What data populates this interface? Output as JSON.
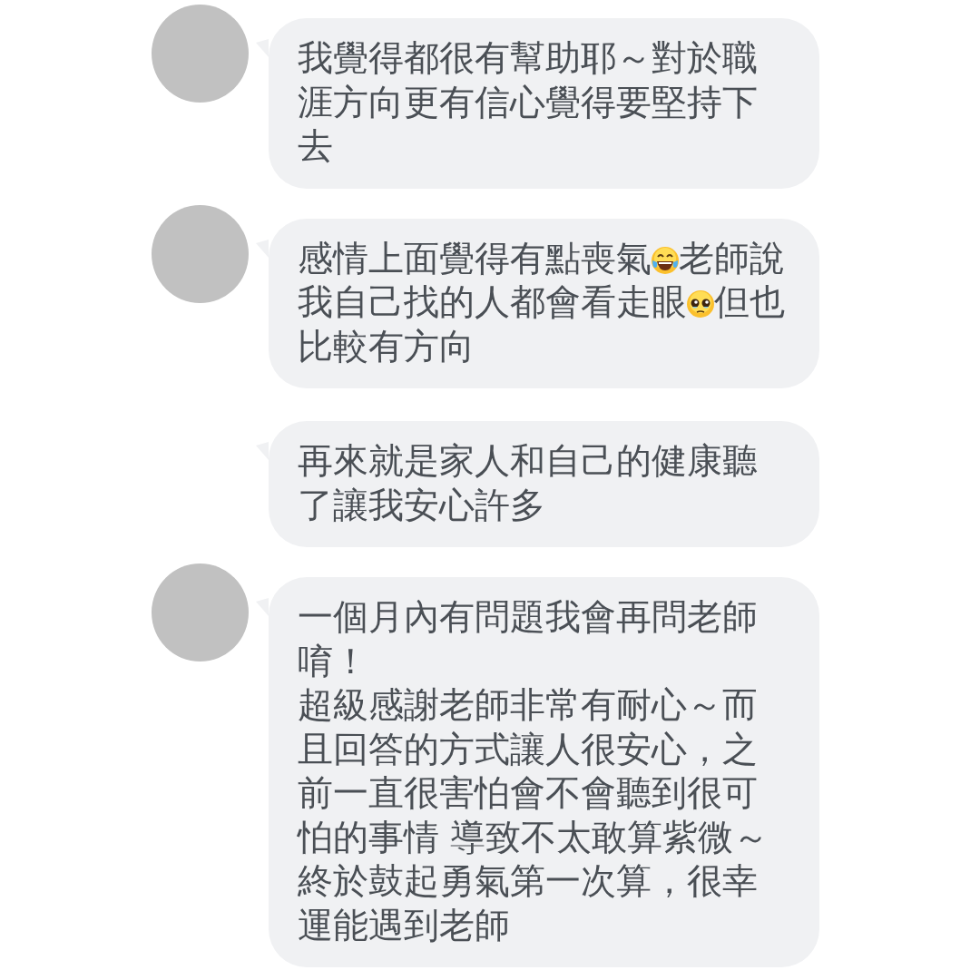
{
  "messages": [
    {
      "show_avatar": true,
      "parts": [
        {
          "kind": "text",
          "text": "我覺得都很有幫助耶～對於職涯方向更有信心覺得要堅持下去"
        }
      ]
    },
    {
      "show_avatar": true,
      "parts": [
        {
          "kind": "text",
          "text": "感情上面覺得有點喪氣"
        },
        {
          "kind": "emoji"
        },
        {
          "kind": "text",
          "text": "老師說我自己找的人都會看走眼"
        },
        {
          "kind": "emoji"
        },
        {
          "kind": "text",
          "text": "但也比較有方向"
        }
      ]
    },
    {
      "show_avatar": false,
      "parts": [
        {
          "kind": "text",
          "text": "再來就是家人和自己的健康聽了讓我安心許多"
        }
      ]
    },
    {
      "show_avatar": true,
      "parts": [
        {
          "kind": "paragraph",
          "text": "一個月內有問題我會再問老師唷！"
        },
        {
          "kind": "paragraph",
          "text": "超級感謝老師非常有耐心～而且回答的方式讓人很安心，之前一直很害怕會不會聽到很可怕的事情 導致不太敢算紫微～終於鼓起勇氣第一次算，很幸運能遇到老師"
        }
      ]
    }
  ]
}
